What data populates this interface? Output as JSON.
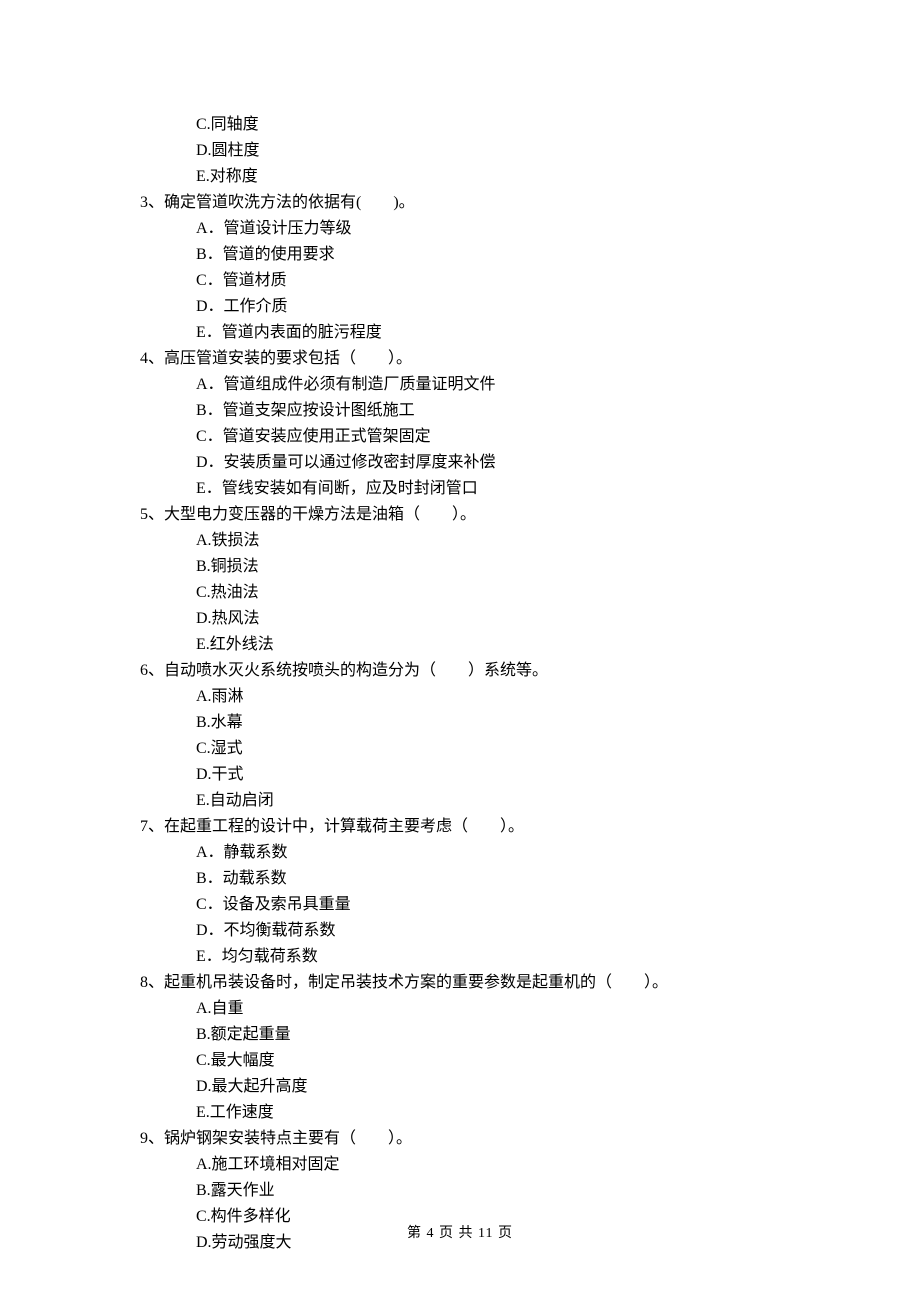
{
  "q2_options_tail": [
    {
      "letter": "C",
      "text": "同轴度"
    },
    {
      "letter": "D",
      "text": "圆柱度"
    },
    {
      "letter": "E",
      "text": "对称度"
    }
  ],
  "questions": [
    {
      "num": "3",
      "stem": "确定管道吹洗方法的依据有(　　)。",
      "options": [
        {
          "letter": "A．",
          "text": "管道设计压力等级"
        },
        {
          "letter": "B．",
          "text": "管道的使用要求"
        },
        {
          "letter": "C．",
          "text": "管道材质"
        },
        {
          "letter": "D．",
          "text": "工作介质"
        },
        {
          "letter": "E．",
          "text": "管道内表面的脏污程度"
        }
      ]
    },
    {
      "num": "4",
      "stem": "高压管道安装的要求包括（　　）。",
      "options": [
        {
          "letter": "A．",
          "text": "管道组成件必须有制造厂质量证明文件"
        },
        {
          "letter": "B．",
          "text": "管道支架应按设计图纸施工"
        },
        {
          "letter": "C．",
          "text": "管道安装应使用正式管架固定"
        },
        {
          "letter": "D．",
          "text": "安装质量可以通过修改密封厚度来补偿"
        },
        {
          "letter": "E．",
          "text": "管线安装如有间断，应及时封闭管口"
        }
      ]
    },
    {
      "num": "5",
      "stem": "大型电力变压器的干燥方法是油箱（　　）。",
      "options": [
        {
          "letter": "A.",
          "text": "铁损法"
        },
        {
          "letter": "B.",
          "text": "铜损法"
        },
        {
          "letter": "C.",
          "text": "热油法"
        },
        {
          "letter": "D.",
          "text": "热风法"
        },
        {
          "letter": "E.",
          "text": "红外线法"
        }
      ]
    },
    {
      "num": "6",
      "stem": "自动喷水灭火系统按喷头的构造分为（　　）系统等。",
      "options": [
        {
          "letter": "A.",
          "text": "雨淋"
        },
        {
          "letter": "B.",
          "text": "水幕"
        },
        {
          "letter": "C.",
          "text": "湿式"
        },
        {
          "letter": "D.",
          "text": "干式"
        },
        {
          "letter": "E.",
          "text": "自动启闭"
        }
      ]
    },
    {
      "num": "7",
      "stem": "在起重工程的设计中，计算载荷主要考虑（　　）。",
      "options": [
        {
          "letter": "A．",
          "text": "静载系数"
        },
        {
          "letter": "B．",
          "text": "动载系数"
        },
        {
          "letter": "C．",
          "text": "设备及索吊具重量"
        },
        {
          "letter": "D．",
          "text": "不均衡载荷系数"
        },
        {
          "letter": "E．",
          "text": "均匀载荷系数"
        }
      ]
    },
    {
      "num": "8",
      "stem": "起重机吊装设备时，制定吊装技术方案的重要参数是起重机的（　　）。",
      "options": [
        {
          "letter": "A.",
          "text": "自重"
        },
        {
          "letter": "B.",
          "text": "额定起重量"
        },
        {
          "letter": "C.",
          "text": "最大幅度"
        },
        {
          "letter": "D.",
          "text": "最大起升高度"
        },
        {
          "letter": "E.",
          "text": "工作速度"
        }
      ]
    },
    {
      "num": "9",
      "stem": "锅炉钢架安装特点主要有（　　）。",
      "options": [
        {
          "letter": "A.",
          "text": "施工环境相对固定"
        },
        {
          "letter": "B.",
          "text": "露天作业"
        },
        {
          "letter": "C.",
          "text": "构件多样化"
        },
        {
          "letter": "D.",
          "text": "劳动强度大"
        }
      ]
    }
  ],
  "footer": "第 4 页 共 11 页"
}
